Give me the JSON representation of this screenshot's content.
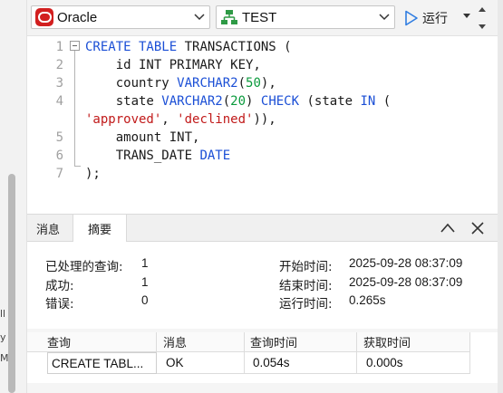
{
  "toolbar": {
    "connection": "Oracle",
    "database": "TEST",
    "run_label": "运行"
  },
  "editor": {
    "line_numbers": [
      "1",
      "2",
      "3",
      "4",
      "",
      "5",
      "6",
      "7"
    ],
    "lines": [
      [
        {
          "t": "CREATE TABLE",
          "c": "kw"
        },
        {
          "t": " TRANSACTIONS (",
          "c": ""
        }
      ],
      [
        {
          "t": "    id INT PRIMARY KEY,",
          "c": ""
        }
      ],
      [
        {
          "t": "    country ",
          "c": ""
        },
        {
          "t": "VARCHAR2",
          "c": "kw"
        },
        {
          "t": "(",
          "c": ""
        },
        {
          "t": "50",
          "c": "num"
        },
        {
          "t": "),",
          "c": ""
        }
      ],
      [
        {
          "t": "    state ",
          "c": ""
        },
        {
          "t": "VARCHAR2",
          "c": "kw"
        },
        {
          "t": "(",
          "c": ""
        },
        {
          "t": "20",
          "c": "num"
        },
        {
          "t": ") ",
          "c": ""
        },
        {
          "t": "CHECK",
          "c": "kw"
        },
        {
          "t": " (state ",
          "c": ""
        },
        {
          "t": "IN",
          "c": "kw"
        },
        {
          "t": " (",
          "c": ""
        }
      ],
      [
        {
          "t": "'approved'",
          "c": "str"
        },
        {
          "t": ", ",
          "c": ""
        },
        {
          "t": "'declined'",
          "c": "str"
        },
        {
          "t": ")),",
          "c": ""
        }
      ],
      [
        {
          "t": "    amount INT,",
          "c": ""
        }
      ],
      [
        {
          "t": "    TRANS_DATE ",
          "c": ""
        },
        {
          "t": "DATE",
          "c": "kw"
        }
      ],
      [
        {
          "t": ");",
          "c": ""
        }
      ]
    ]
  },
  "panel": {
    "tabs": [
      "消息",
      "摘要"
    ],
    "active_tab": 1
  },
  "summary": {
    "processed_label": "已处理的查询:",
    "processed_value": "1",
    "success_label": "成功:",
    "success_value": "1",
    "error_label": "错误:",
    "error_value": "0",
    "start_label": "开始时间:",
    "start_value": "2025-09-28 08:37:09",
    "end_label": "结束时间:",
    "end_value": "2025-09-28 08:37:09",
    "elapsed_label": "运行时间:",
    "elapsed_value": "0.265s"
  },
  "results": {
    "headers": [
      "查询",
      "消息",
      "查询时间",
      "获取时间"
    ],
    "rows": [
      [
        "CREATE TABL...",
        "OK",
        "0.054s",
        "0.000s"
      ]
    ]
  },
  "left_edge": {
    "fragments": [
      "ll",
      "y",
      "M"
    ]
  },
  "colors": {
    "keyword": "#1b4fd6",
    "number": "#0a9a3c",
    "string": "#c11a1a",
    "run_icon": "#2f7de1",
    "oracle": "#d21f1f"
  }
}
